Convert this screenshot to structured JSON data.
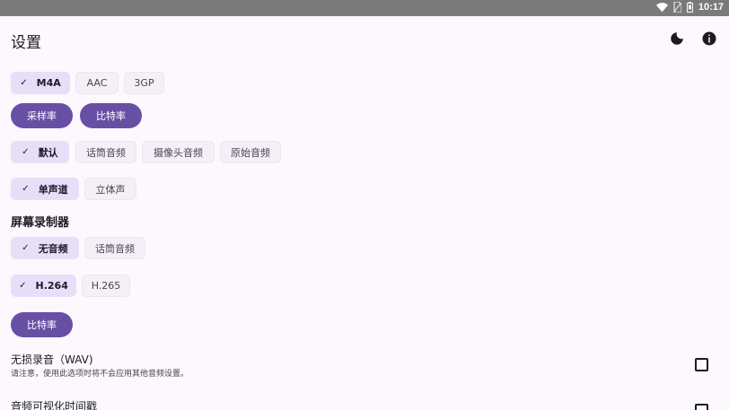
{
  "status": {
    "time": "10:17"
  },
  "appbar": {
    "title": "设置",
    "icons": [
      "moon-icon",
      "info-icon"
    ]
  },
  "format_chips": [
    {
      "label": "M4A",
      "selected": true
    },
    {
      "label": "AAC",
      "selected": false
    },
    {
      "label": "3GP",
      "selected": false
    }
  ],
  "audio_buttons": {
    "sample_rate": "采样率",
    "bitrate": "比特率"
  },
  "source_chips": [
    {
      "label": "默认",
      "selected": true
    },
    {
      "label": "话筒音频",
      "selected": false
    },
    {
      "label": "摄像头音频",
      "selected": false
    },
    {
      "label": "原始音频",
      "selected": false
    }
  ],
  "channel_chips": [
    {
      "label": "单声道",
      "selected": true
    },
    {
      "label": "立体声",
      "selected": false
    }
  ],
  "screen_recorder": {
    "title": "屏幕录制器",
    "audio_chips": [
      {
        "label": "无音频",
        "selected": true
      },
      {
        "label": "话筒音频",
        "selected": false
      }
    ],
    "codec_chips": [
      {
        "label": "H.264",
        "selected": true
      },
      {
        "label": "H.265",
        "selected": false
      }
    ],
    "bitrate": "比特率"
  },
  "lossless": {
    "title": "无损录音（WAV)",
    "desc": "请注意，使用此选项时将不会应用其他音频设置。",
    "checked": false
  },
  "visual_timestamp": {
    "title": "音频可视化时间戳",
    "checked": false
  }
}
